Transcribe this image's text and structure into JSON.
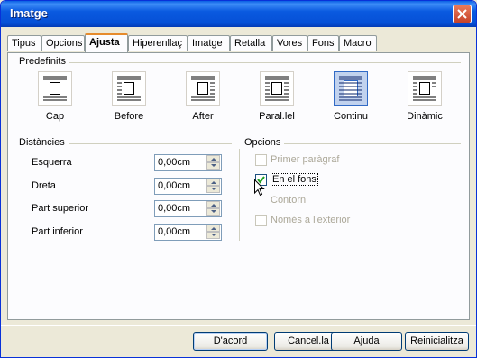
{
  "window": {
    "title": "Imatge"
  },
  "tabs": [
    {
      "label": "Tipus",
      "active": false
    },
    {
      "label": "Opcions",
      "active": false
    },
    {
      "label": "Ajusta",
      "active": true
    },
    {
      "label": "Hiperenllaç",
      "active": false
    },
    {
      "label": "Imatge",
      "active": false
    },
    {
      "label": "Retalla",
      "active": false
    },
    {
      "label": "Vores",
      "active": false
    },
    {
      "label": "Fons",
      "active": false
    },
    {
      "label": "Macro",
      "active": false
    }
  ],
  "presets": {
    "group_label": "Predefinits",
    "items": [
      {
        "label": "Cap",
        "icon": "wrap-none-icon",
        "selected": false
      },
      {
        "label": "Before",
        "icon": "wrap-before-icon",
        "selected": false
      },
      {
        "label": "After",
        "icon": "wrap-after-icon",
        "selected": false
      },
      {
        "label": "Paral.lel",
        "icon": "wrap-parallel-icon",
        "selected": false
      },
      {
        "label": "Continu",
        "icon": "wrap-through-icon",
        "selected": true
      },
      {
        "label": "Dinàmic",
        "icon": "wrap-optimal-icon",
        "selected": false
      }
    ]
  },
  "spacing": {
    "group_label": "Distàncies",
    "fields": [
      {
        "label": "Esquerra",
        "value": "0,00cm"
      },
      {
        "label": "Dreta",
        "value": "0,00cm"
      },
      {
        "label": "Part superior",
        "value": "0,00cm"
      },
      {
        "label": "Part inferior",
        "value": "0,00cm"
      }
    ]
  },
  "options": {
    "group_label": "Opcions",
    "first_paragraph": {
      "label": "Primer paràgraf",
      "checked": false,
      "enabled": false
    },
    "in_background": {
      "label": "En el fons",
      "checked": true,
      "enabled": true
    },
    "contour": {
      "label": "Contorn",
      "checked": false,
      "enabled": false
    },
    "outside_only": {
      "label": "Només a l'exterior",
      "checked": false,
      "enabled": false
    }
  },
  "buttons": {
    "ok": "D'acord",
    "cancel": "Cancel.la",
    "help": "Ajuda",
    "reset": "Reinicialitza"
  },
  "colors": {
    "titlebar": "#0a5ae0",
    "active_tab_accent": "#e68b2c",
    "dialog_bg": "#ece9d8"
  }
}
